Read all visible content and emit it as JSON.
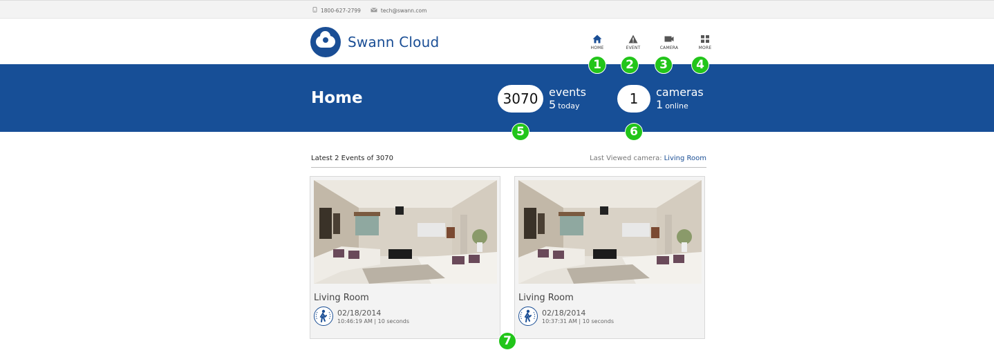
{
  "contact": {
    "phone": "1800-627-2799",
    "email": "tech@swann.com"
  },
  "brand": {
    "name": "Swann Cloud"
  },
  "nav": [
    {
      "label": "HOME",
      "icon": "home-icon",
      "active": true
    },
    {
      "label": "EVENT",
      "icon": "warning-icon"
    },
    {
      "label": "CAMERA",
      "icon": "camera-icon"
    },
    {
      "label": "MORE",
      "icon": "grid-icon"
    }
  ],
  "annotations": [
    "1",
    "2",
    "3",
    "4",
    "5",
    "6",
    "7"
  ],
  "banner": {
    "title": "Home",
    "events": {
      "count": "3070",
      "label": "events",
      "today_count": "5",
      "today_label": "today"
    },
    "cameras": {
      "count": "1",
      "label": "cameras",
      "online_count": "1",
      "online_label": "online"
    }
  },
  "events_list": {
    "heading": "Latest 2 Events of 3070",
    "last_viewed_label": "Last Viewed camera:",
    "last_viewed_camera": "Living Room",
    "items": [
      {
        "camera": "Living Room",
        "date": "02/18/2014",
        "time": "10:46:19 AM | 10 seconds",
        "icon": "motion-detection-icon"
      },
      {
        "camera": "Living Room",
        "date": "02/18/2014",
        "time": "10:37:31 AM | 10 seconds",
        "icon": "motion-detection-icon"
      }
    ]
  },
  "colors": {
    "brand_blue": "#174f97",
    "badge_green": "#22c51a"
  }
}
